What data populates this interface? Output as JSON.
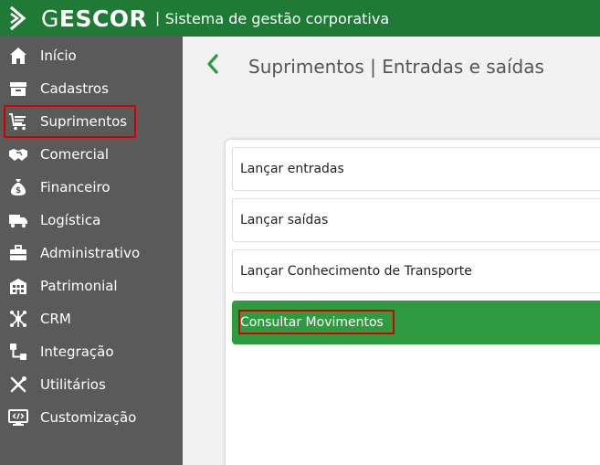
{
  "header": {
    "brand_first": "G",
    "brand_rest": "ESCOR",
    "separator": "|",
    "subtitle": "Sistema de gestão corporativa",
    "color": "#1e7a34"
  },
  "sidebar": {
    "items": [
      {
        "label": "Início",
        "icon": "home-icon"
      },
      {
        "label": "Cadastros",
        "icon": "archive-box-icon"
      },
      {
        "label": "Suprimentos",
        "icon": "shopping-cart-icon"
      },
      {
        "label": "Comercial",
        "icon": "handshake-icon"
      },
      {
        "label": "Financeiro",
        "icon": "money-bag-icon"
      },
      {
        "label": "Logística",
        "icon": "truck-icon"
      },
      {
        "label": "Administrativo",
        "icon": "briefcase-icon"
      },
      {
        "label": "Patrimonial",
        "icon": "building-icon"
      },
      {
        "label": "CRM",
        "icon": "network-icon"
      },
      {
        "label": "Integração",
        "icon": "integration-icon"
      },
      {
        "label": "Utilitários",
        "icon": "tools-icon"
      },
      {
        "label": "Customização",
        "icon": "code-monitor-icon"
      }
    ],
    "selected": "Suprimentos"
  },
  "main": {
    "title": "Suprimentos | Entradas e saídas",
    "options": [
      {
        "label": "Lançar entradas"
      },
      {
        "label": "Lançar saídas"
      },
      {
        "label": "Lançar Conhecimento de Transporte"
      },
      {
        "label": "Consultar Movimentos",
        "active": true
      }
    ],
    "accent": "#2e9b40"
  }
}
